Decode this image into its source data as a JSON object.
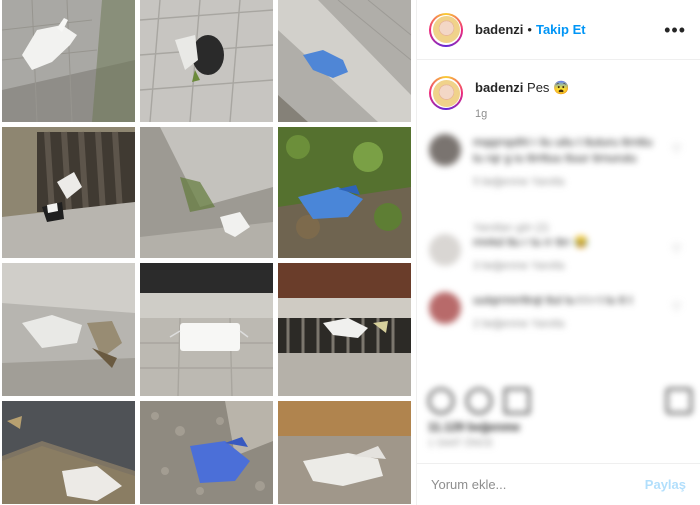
{
  "grid": {
    "photos": [
      {
        "name": "photo-white-glove-pavement"
      },
      {
        "name": "photo-black-glove-tiles"
      },
      {
        "name": "photo-blue-glove-curb"
      },
      {
        "name": "photo-gloves-drain"
      },
      {
        "name": "photo-white-glove-curb"
      },
      {
        "name": "photo-blue-glove-grass"
      },
      {
        "name": "photo-clear-glove-leaves"
      },
      {
        "name": "photo-mask-street"
      },
      {
        "name": "photo-glove-drain-grate"
      },
      {
        "name": "photo-clear-glove-water"
      },
      {
        "name": "photo-blue-glove-gravel"
      },
      {
        "name": "photo-clear-glove-sand"
      }
    ]
  },
  "header": {
    "username": "badenzi",
    "separator": "•",
    "follow_label": "Takip Et",
    "more_icon": "more-horizontal-icon"
  },
  "caption": {
    "username": "badenzi",
    "text": "Pes 😨",
    "time": "1g"
  },
  "comments_blurred": [
    {
      "text": "mqqrrqslhl r ilu uitu t ttuturu ttrnttu tu rqr g iu ttrrttuu ttuur tirnurutu",
      "meta": "5 beğenme Yanıtla",
      "reply": "Yanıtları gör (2)",
      "avatar_color": "#7a7470"
    },
    {
      "text": "rmrkd ttu r tu rr ttrr 😂",
      "meta": "3 beğenme Yanıtla",
      "reply": "",
      "avatar_color": "#d9d6d3"
    },
    {
      "text": "uutqrrmrrltrqt ttul tu t t r t tu tt t",
      "meta": "2 beğenme Yanıtla",
      "reply": "",
      "avatar_color": "#b86a6a"
    }
  ],
  "stats": {
    "likes": "11.129 beğenme",
    "date": "1 SAAT ÖNCE"
  },
  "comment_box": {
    "placeholder": "Yorum ekle...",
    "post_label": "Paylaş"
  },
  "colors": {
    "accent": "#0095f6",
    "post_disabled": "#b2dffc",
    "muted": "#8e8e8e"
  }
}
